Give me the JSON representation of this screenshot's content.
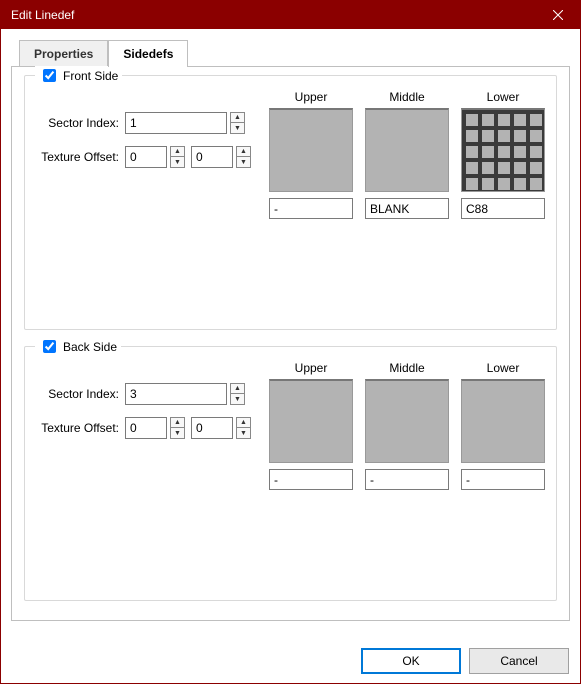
{
  "window": {
    "title": "Edit Linedef"
  },
  "tabs": {
    "properties": "Properties",
    "sidedefs": "Sidedefs"
  },
  "labels": {
    "sector_index": "Sector Index:",
    "texture_offset": "Texture Offset:",
    "upper": "Upper",
    "middle": "Middle",
    "lower": "Lower",
    "front_side": "Front Side",
    "back_side": "Back Side"
  },
  "front": {
    "enabled": true,
    "sector_index": "1",
    "offx": "0",
    "offy": "0",
    "upper": "-",
    "middle": "BLANK",
    "lower": "C88"
  },
  "back": {
    "enabled": true,
    "sector_index": "3",
    "offx": "0",
    "offy": "0",
    "upper": "-",
    "middle": "-",
    "lower": "-"
  },
  "buttons": {
    "ok": "OK",
    "cancel": "Cancel"
  }
}
